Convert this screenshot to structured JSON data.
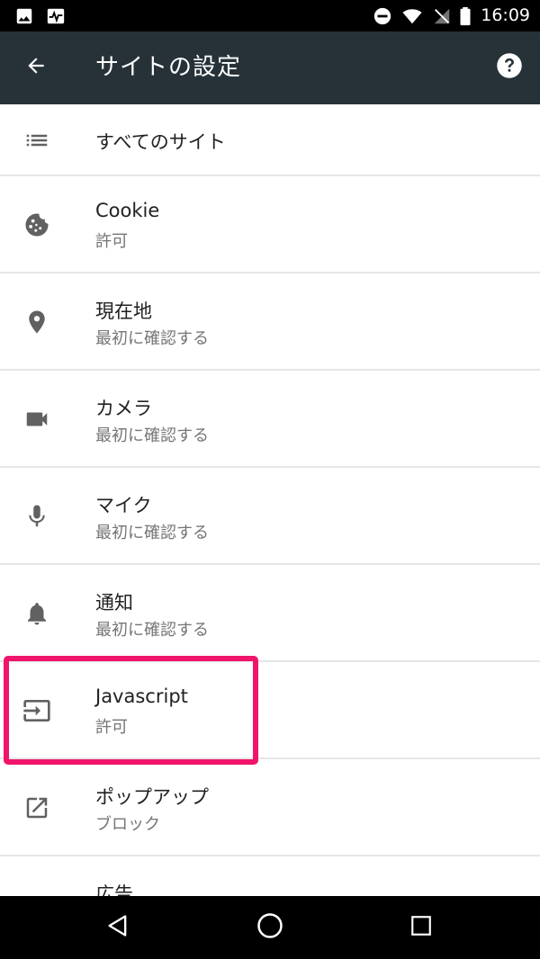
{
  "status_bar": {
    "time": "16:09",
    "left_icons": [
      "image-icon",
      "activity-icon"
    ],
    "right_icons": [
      "do-not-disturb-icon",
      "wifi-icon",
      "no-sim-icon",
      "battery-icon"
    ]
  },
  "toolbar": {
    "title": "サイトの設定",
    "back_icon": "arrow-back-icon",
    "help_icon": "help-icon",
    "background": "#263238"
  },
  "items": [
    {
      "icon": "list-icon",
      "title": "すべてのサイト",
      "subtitle": ""
    },
    {
      "icon": "cookie-icon",
      "title": "Cookie",
      "subtitle": "許可"
    },
    {
      "icon": "location-pin-icon",
      "title": "現在地",
      "subtitle": "最初に確認する"
    },
    {
      "icon": "camera-icon",
      "title": "カメラ",
      "subtitle": "最初に確認する"
    },
    {
      "icon": "microphone-icon",
      "title": "マイク",
      "subtitle": "最初に確認する"
    },
    {
      "icon": "bell-icon",
      "title": "通知",
      "subtitle": "最初に確認する"
    },
    {
      "icon": "input-arrow-icon",
      "title": "Javascript",
      "subtitle": "許可"
    },
    {
      "icon": "open-external-icon",
      "title": "ポップアップ",
      "subtitle": "ブロック"
    },
    {
      "icon": "ads-icon",
      "title": "広告",
      "subtitle": ""
    }
  ],
  "highlight": {
    "target": "Javascript",
    "color": "#f0156a"
  },
  "nav_bar": {
    "buttons": [
      "back-triangle-icon",
      "home-circle-icon",
      "recents-square-icon"
    ]
  }
}
